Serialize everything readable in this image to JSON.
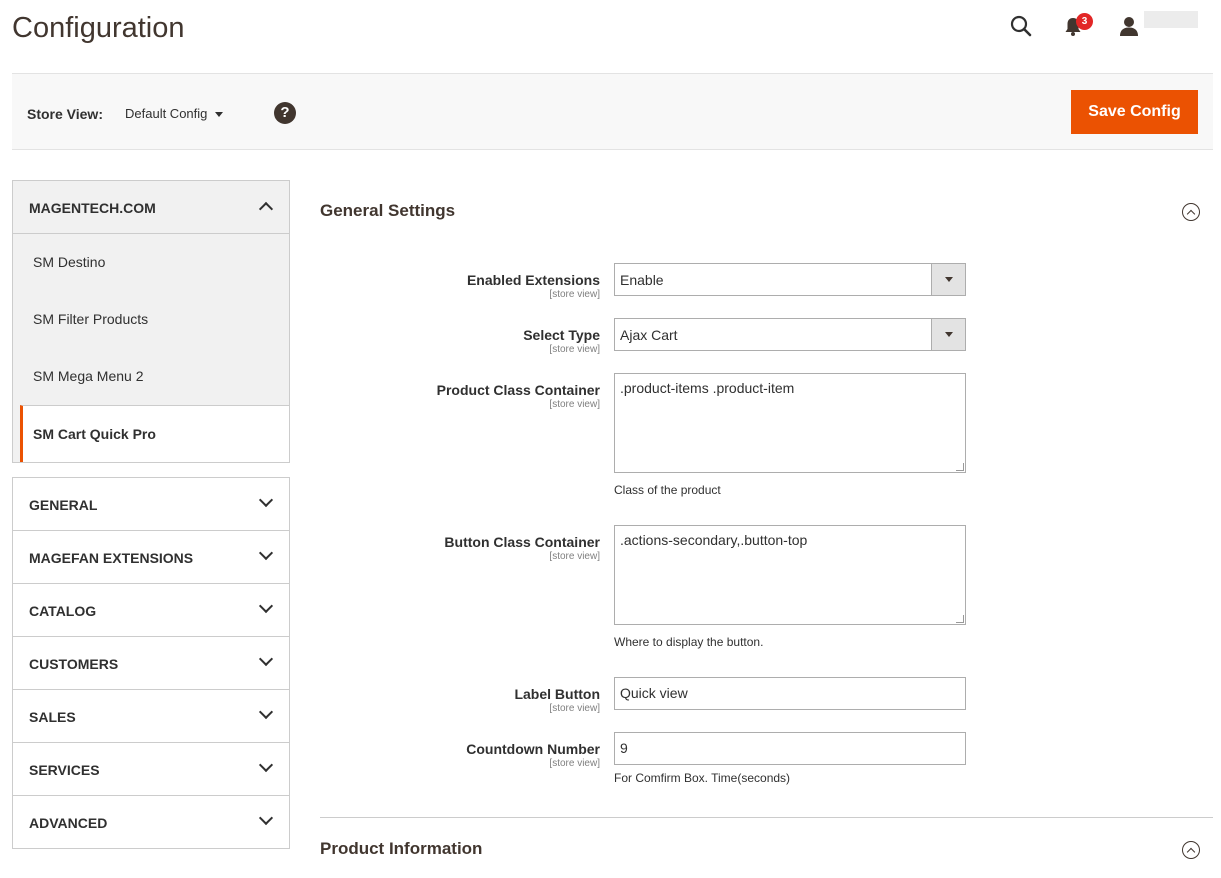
{
  "header": {
    "title": "Configuration",
    "notifications_count": "3"
  },
  "store_bar": {
    "label": "Store View:",
    "value": "Default Config",
    "help": "?",
    "save_label": "Save Config"
  },
  "sidebar": {
    "expanded_group": {
      "label": "MAGENTECH.COM",
      "items": [
        {
          "label": "SM Destino"
        },
        {
          "label": "SM Filter Products"
        },
        {
          "label": "SM Mega Menu 2"
        },
        {
          "label": "SM Cart Quick Pro"
        }
      ]
    },
    "groups": [
      {
        "label": "GENERAL"
      },
      {
        "label": "MAGEFAN EXTENSIONS"
      },
      {
        "label": "CATALOG"
      },
      {
        "label": "CUSTOMERS"
      },
      {
        "label": "SALES"
      },
      {
        "label": "SERVICES"
      },
      {
        "label": "ADVANCED"
      }
    ]
  },
  "general_settings": {
    "title": "General Settings",
    "fields": {
      "enabled_extensions": {
        "label": "Enabled Extensions",
        "scope": "[store view]",
        "value": "Enable"
      },
      "select_type": {
        "label": "Select Type",
        "scope": "[store view]",
        "value": "Ajax Cart"
      },
      "product_class_container": {
        "label": "Product Class Container",
        "scope": "[store view]",
        "value": ".product-items .product-item",
        "note": "Class of the product"
      },
      "button_class_container": {
        "label": "Button Class Container",
        "scope": "[store view]",
        "value": ".actions-secondary,.button-top",
        "note": "Where to display the button."
      },
      "label_button": {
        "label": "Label Button",
        "scope": "[store view]",
        "value": "Quick view"
      },
      "countdown_number": {
        "label": "Countdown Number",
        "scope": "[store view]",
        "value": "9",
        "note": "For Comfirm Box. Time(seconds)"
      }
    }
  },
  "product_information": {
    "title": "Product Information"
  },
  "colors": {
    "accent": "#eb5202",
    "title_text": "#41362f",
    "badge": "#e22626"
  }
}
